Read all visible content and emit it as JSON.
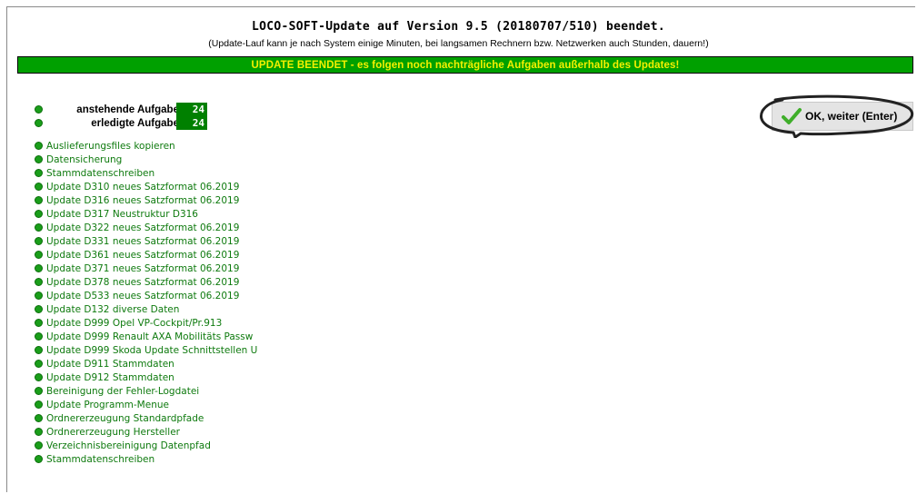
{
  "header": {
    "title": "LOCO-SOFT-Update auf Version 9.5  (20180707/510) beendet.",
    "subtitle": "(Update-Lauf kann je nach System einige Minuten, bei langsamen Rechnern bzw. Netzwerken auch Stunden, dauern!)"
  },
  "banner": {
    "text": "UPDATE BEENDET - es folgen noch nachträgliche Aufgaben außerhalb des Updates!",
    "background": "#00a000",
    "text_color": "#f5f000"
  },
  "counters": [
    {
      "label": "anstehende Aufgaben",
      "value": "24"
    },
    {
      "label": "erledigte Aufgaben",
      "value": "24"
    }
  ],
  "ok_button": {
    "label": "OK, weiter (Enter)",
    "icon": "checkmark-icon"
  },
  "tasks": [
    "Auslieferungsfiles kopieren",
    "Datensicherung",
    "Stammdatenschreiben",
    "Update D310 neues Satzformat 06.2019",
    "Update D316 neues Satzformat 06.2019",
    "Update D317 Neustruktur D316",
    "Update D322 neues Satzformat 06.2019",
    "Update D331 neues Satzformat 06.2019",
    "Update D361 neues Satzformat 06.2019",
    "Update D371 neues Satzformat 06.2019",
    "Update D378 neues Satzformat 06.2019",
    "Update D533 neues Satzformat 06.2019",
    "Update D132 diverse Daten",
    "Update D999 Opel VP-Cockpit/Pr.913",
    "Update D999 Renault AXA Mobilitäts Passw",
    "Update D999 Skoda Update Schnittstellen U",
    "Update D911 Stammdaten",
    "Update D912 Stammdaten",
    "Bereinigung der Fehler-Logdatei",
    "Update Programm-Menue",
    "Ordnererzeugung Standardpfade",
    "Ordnererzeugung Hersteller",
    "Verzeichnisbereinigung Datenpfad",
    "Stammdatenschreiben"
  ]
}
